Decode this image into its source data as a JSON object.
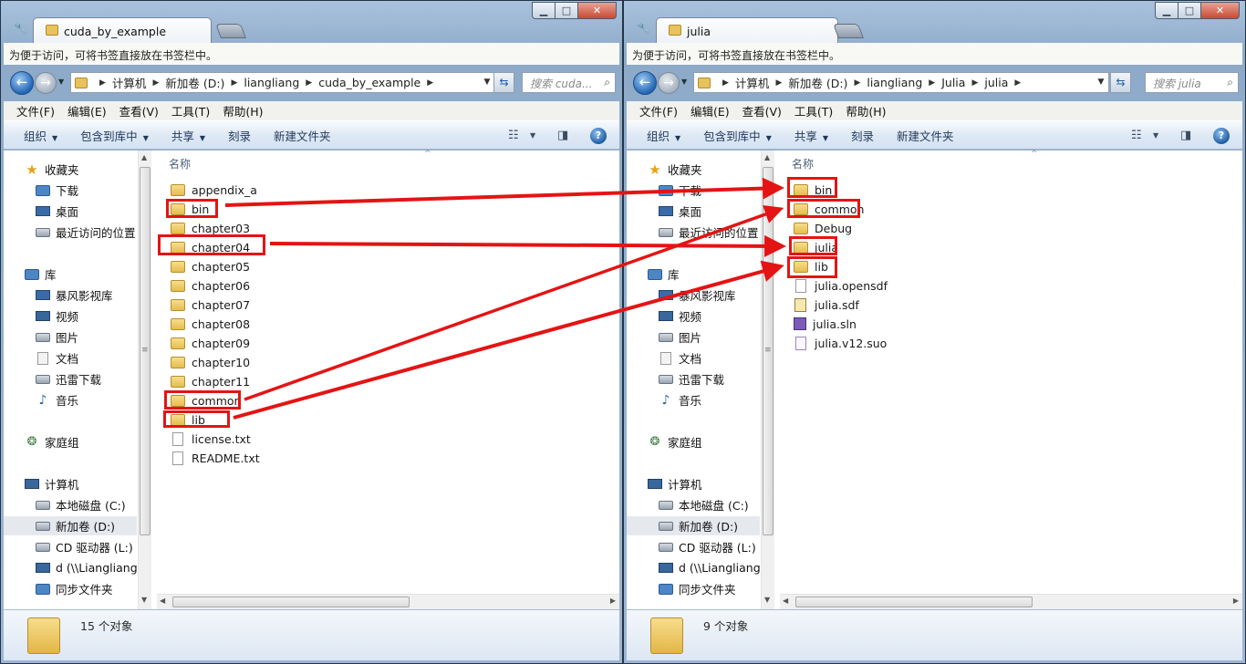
{
  "left_window": {
    "tab_title": "cuda_by_example",
    "bookmark_hint": "为便于访问，可将书签直接放在书签栏中。",
    "breadcrumb": [
      "计算机",
      "新加卷 (D:)",
      "liangliang",
      "cuda_by_example"
    ],
    "search_placeholder": "搜索 cuda...",
    "menu": [
      "文件(F)",
      "编辑(E)",
      "查看(V)",
      "工具(T)",
      "帮助(H)"
    ],
    "commands": [
      "组织",
      "包含到库中",
      "共享",
      "刻录",
      "新建文件夹"
    ],
    "column_name": "名称",
    "files": [
      {
        "name": "appendix_a",
        "type": "folder"
      },
      {
        "name": "bin",
        "type": "folder"
      },
      {
        "name": "chapter03",
        "type": "folder"
      },
      {
        "name": "chapter04",
        "type": "folder"
      },
      {
        "name": "chapter05",
        "type": "folder"
      },
      {
        "name": "chapter06",
        "type": "folder"
      },
      {
        "name": "chapter07",
        "type": "folder"
      },
      {
        "name": "chapter08",
        "type": "folder"
      },
      {
        "name": "chapter09",
        "type": "folder"
      },
      {
        "name": "chapter10",
        "type": "folder"
      },
      {
        "name": "chapter11",
        "type": "folder"
      },
      {
        "name": "common",
        "type": "folder"
      },
      {
        "name": "lib",
        "type": "folder"
      },
      {
        "name": "license.txt",
        "type": "file"
      },
      {
        "name": "README.txt",
        "type": "file"
      }
    ],
    "status": "15 个对象"
  },
  "right_window": {
    "tab_title": "julia",
    "bookmark_hint": "为便于访问，可将书签直接放在书签栏中。",
    "breadcrumb": [
      "计算机",
      "新加卷 (D:)",
      "liangliang",
      "Julia",
      "julia"
    ],
    "search_placeholder": "搜索 julia",
    "menu": [
      "文件(F)",
      "编辑(E)",
      "查看(V)",
      "工具(T)",
      "帮助(H)"
    ],
    "commands": [
      "组织",
      "包含到库中",
      "共享",
      "刻录",
      "新建文件夹"
    ],
    "column_name": "名称",
    "files": [
      {
        "name": "bin",
        "type": "folder"
      },
      {
        "name": "common",
        "type": "folder"
      },
      {
        "name": "Debug",
        "type": "folder"
      },
      {
        "name": "julia",
        "type": "folder"
      },
      {
        "name": "lib",
        "type": "folder"
      },
      {
        "name": "julia.opensdf",
        "type": "file"
      },
      {
        "name": "julia.sdf",
        "type": "sdf"
      },
      {
        "name": "julia.sln",
        "type": "sln"
      },
      {
        "name": "julia.v12.suo",
        "type": "suo"
      }
    ],
    "status": "9 个对象"
  },
  "nav_pane": {
    "items": [
      {
        "label": "收藏夹",
        "icon": "star-icon"
      },
      {
        "label": "下载",
        "icon": "downloads-folder-icon"
      },
      {
        "label": "桌面",
        "icon": "desktop-icon"
      },
      {
        "label": "最近访问的位置",
        "icon": "recent-places-icon"
      },
      {
        "label": "库",
        "icon": "libraries-icon"
      },
      {
        "label": "暴风影视库",
        "icon": "video-library-icon"
      },
      {
        "label": "视频",
        "icon": "videos-icon"
      },
      {
        "label": "图片",
        "icon": "pictures-icon"
      },
      {
        "label": "文档",
        "icon": "documents-icon"
      },
      {
        "label": "迅雷下载",
        "icon": "xunlei-folder-icon"
      },
      {
        "label": "音乐",
        "icon": "music-icon"
      },
      {
        "label": "家庭组",
        "icon": "homegroup-icon"
      },
      {
        "label": "计算机",
        "icon": "computer-icon"
      },
      {
        "label": "本地磁盘 (C:)",
        "icon": "local-disk-icon"
      },
      {
        "label": "新加卷 (D:)",
        "icon": "drive-icon"
      },
      {
        "label": "CD 驱动器 (L:)",
        "icon": "cd-drive-icon"
      },
      {
        "label": "d (\\\\Liangliang-",
        "icon": "network-drive-icon"
      },
      {
        "label": "同步文件夹",
        "icon": "sync-folder-icon"
      }
    ]
  },
  "annotation_color": "#e41414"
}
